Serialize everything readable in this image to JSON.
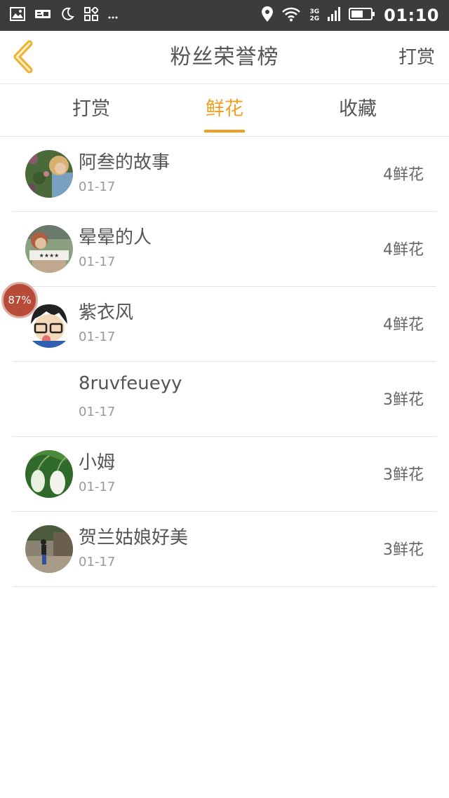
{
  "status_bar": {
    "time": "01:10",
    "network": [
      "3G",
      "2G"
    ],
    "icons": [
      "image-icon",
      "notification-icon",
      "moon-icon",
      "apps-icon",
      "more-icon",
      "location-icon",
      "wifi-icon",
      "signal-icon",
      "battery-icon"
    ]
  },
  "header": {
    "title": "粉丝荣誉榜",
    "right_action": "打赏",
    "back_icon": "chevron-left-icon"
  },
  "tabs": [
    {
      "label": "打赏",
      "active": false
    },
    {
      "label": "鲜花",
      "active": true
    },
    {
      "label": "收藏",
      "active": false
    }
  ],
  "list": [
    {
      "name": "阿叁的故事",
      "date": "01-17",
      "count": "4鲜花",
      "avatar": "photo-woman-flowers"
    },
    {
      "name": "晕晕的人",
      "date": "01-17",
      "count": "4鲜花",
      "avatar": "photo-woman-sign"
    },
    {
      "name": "紫衣风",
      "date": "01-17",
      "count": "4鲜花",
      "avatar": "cartoon-boy-glasses"
    },
    {
      "name": "8ruvfeueyy",
      "date": "01-17",
      "count": "3鲜花",
      "avatar": ""
    },
    {
      "name": "小姆",
      "date": "01-17",
      "count": "3鲜花",
      "avatar": "photo-green-leaves"
    },
    {
      "name": "贺兰姑娘好美",
      "date": "01-17",
      "count": "3鲜花",
      "avatar": "photo-street"
    }
  ],
  "float_badge": "87%",
  "colors": {
    "accent": "#f0a020",
    "status_bar_bg": "#3c3c3c",
    "text_primary": "#555555",
    "text_secondary": "#999999",
    "divider": "#e2e2e2",
    "badge": "#b84a38"
  }
}
